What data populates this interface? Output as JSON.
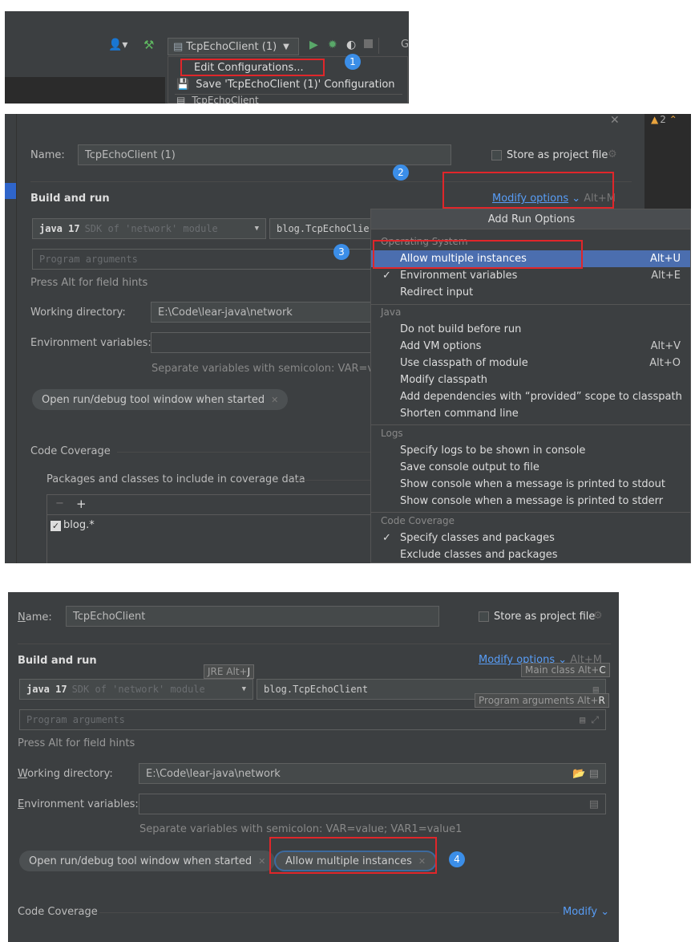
{
  "panel1": {
    "run_config": "TcpEchoClient (1)",
    "dropdown": {
      "edit": "Edit Configurations...",
      "save": "Save 'TcpEchoClient (1)' Configuration",
      "partial": "TcpEchoClient"
    },
    "badge": "1"
  },
  "panel2": {
    "name_label": "Name:",
    "name_value": "TcpEchoClient (1)",
    "store_label": "Store as project file",
    "warning_count": "2",
    "build_run": "Build and run",
    "modify_options": "Modify options",
    "modify_shortcut": "Alt+M",
    "java_sdk_bold": "java 17",
    "java_sdk_rest": "SDK of 'network' module",
    "main_class": "blog.TcpEchoClie",
    "program_args_placeholder": "Program arguments",
    "field_hints": "Press Alt for field hints",
    "working_dir_label": "Working directory:",
    "working_dir_value": "E:\\Code\\lear-java\\network",
    "env_label": "Environment variables:",
    "env_hint": "Separate variables with semicolon: VAR=valu",
    "open_tool_pill": "Open run/debug tool window when started",
    "code_coverage": "Code Coverage",
    "packages_label": "Packages and classes to include in coverage data",
    "coverage_item": "blog.*",
    "badge2": "2",
    "badge3": "3",
    "popup": {
      "title": "Add Run Options",
      "os_section": "Operating System",
      "allow_multiple": "Allow multiple instances",
      "allow_multiple_sc": "Alt+U",
      "env_vars": "Environment variables",
      "env_vars_sc": "Alt+E",
      "redirect": "Redirect input",
      "java_section": "Java",
      "dont_build": "Do not build before run",
      "vm_options": "Add VM options",
      "vm_options_sc": "Alt+V",
      "classpath": "Use classpath of module",
      "classpath_sc": "Alt+O",
      "modify_classpath": "Modify classpath",
      "provided_scope": "Add dependencies with “provided” scope to classpath",
      "shorten": "Shorten command line",
      "logs_section": "Logs",
      "logs_console": "Specify logs to be shown in console",
      "save_console": "Save console output to file",
      "show_stdout": "Show console when a message is printed to stdout",
      "show_stderr": "Show console when a message is printed to stderr",
      "coverage_section": "Code Coverage",
      "specify_classes": "Specify classes and packages",
      "exclude_classes": "Exclude classes and packages"
    }
  },
  "panel3": {
    "name_label": "Name:",
    "name_value": "TcpEchoClient",
    "store_label": "Store as project file",
    "build_run": "Build and run",
    "modify_options": "Modify options",
    "modify_shortcut": "Alt+M",
    "jre_tip": "JRE Alt+",
    "jre_key": "J",
    "main_class_tip": "Main class Alt+",
    "main_class_key": "C",
    "java_sdk_bold": "java 17",
    "java_sdk_rest": "SDK of 'network' module",
    "main_class": "blog.TcpEchoClient",
    "program_args_tip": "Program arguments Alt+",
    "program_args_key": "R",
    "program_args_placeholder": "Program arguments",
    "field_hints": "Press Alt for field hints",
    "working_dir_label": "Working directory:",
    "working_dir_value": "E:\\Code\\lear-java\\network",
    "env_label": "Environment variables:",
    "env_hint": "Separate variables with semicolon: VAR=value; VAR1=value1",
    "open_tool_pill": "Open run/debug tool window when started",
    "allow_pill": "Allow multiple instances",
    "badge4": "4",
    "code_coverage": "Code Coverage",
    "modify": "Modify"
  }
}
